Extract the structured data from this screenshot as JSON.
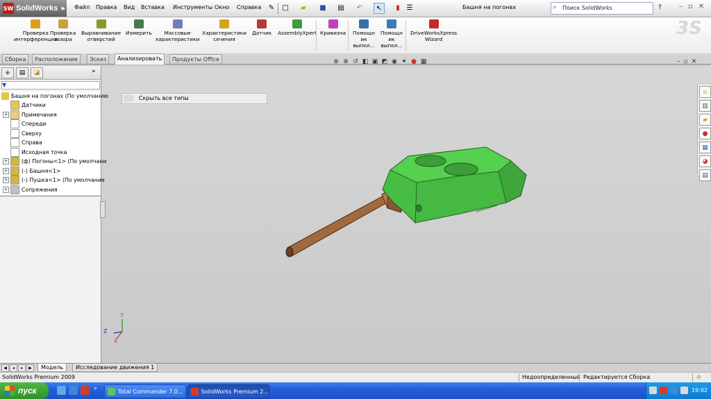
{
  "titlebar": {
    "app_name": "SolidWorks",
    "menu": [
      "Файл",
      "Правка",
      "Вид",
      "Вставка",
      "Инструменты",
      "Окно",
      "Справка"
    ],
    "document_title": "Башня на погонах",
    "search_placeholder": "Поиск SolidWorks",
    "help_label": "?"
  },
  "command_manager": {
    "items": [
      {
        "label": "Проверка\nинтерференции",
        "icon": "interference-check-icon",
        "color": "#d9a01b"
      },
      {
        "label": "Проверка\nзазора",
        "icon": "clearance-check-icon",
        "color": "#c8a23a"
      },
      {
        "label": "Выравнивание\nотверстий",
        "icon": "hole-alignment-icon",
        "color": "#8a9a2a"
      },
      {
        "label": "Измерить",
        "icon": "measure-icon",
        "color": "#4a7a4a"
      },
      {
        "label": "Массовые\nхарактеристики",
        "icon": "mass-properties-icon",
        "color": "#6f7fb5"
      },
      {
        "label": "Характеристики\nсечения",
        "icon": "section-properties-icon",
        "color": "#d4a41c"
      },
      {
        "label": "Датчик",
        "icon": "sensor-icon",
        "color": "#b53a3a"
      },
      {
        "label": "AssemblyXpert",
        "icon": "assemblyxpert-icon",
        "color": "#3c9d3c"
      },
      {
        "label": "Кривизна",
        "icon": "curvature-icon",
        "color": "#c23fbf"
      },
      {
        "label": "Помощн\nик\nвыпол...",
        "icon": "wizard-icon",
        "color": "#3a6fa9"
      },
      {
        "label": "Помощн\nик\nвыпол...",
        "icon": "wizard2-icon",
        "color": "#3c7bb3"
      },
      {
        "label": "DriveWorksXpress\nWizard",
        "icon": "driveworks-icon",
        "color": "#c52a2a"
      }
    ]
  },
  "tabs": [
    "Сборка",
    "Расположение",
    "Эскиз",
    "Анализировать",
    "Продукты Office"
  ],
  "active_tab": "Анализировать",
  "feature_tree": {
    "root": "Башня на погонах  (По умолчанию",
    "nodes": [
      {
        "label": "Датчики",
        "icon": "sensors-icon",
        "expandable": false
      },
      {
        "label": "Примечания",
        "icon": "annotations-icon",
        "expandable": true
      },
      {
        "label": "Спереди",
        "icon": "plane-icon",
        "expandable": false
      },
      {
        "label": "Сверху",
        "icon": "plane-icon",
        "expandable": false
      },
      {
        "label": "Справа",
        "icon": "plane-icon",
        "expandable": false
      },
      {
        "label": "Исходная точка",
        "icon": "origin-icon",
        "expandable": false
      },
      {
        "label": "(ф) Погоны<1> (По умолчани",
        "icon": "part-icon",
        "expandable": true
      },
      {
        "label": "(-) Башня<1>",
        "icon": "part-icon",
        "expandable": true
      },
      {
        "label": "(-) Пушка<1> (По умолчание",
        "icon": "part-icon",
        "expandable": true
      },
      {
        "label": "Сопряжения",
        "icon": "mates-icon",
        "expandable": true
      }
    ]
  },
  "context_menu": {
    "item": "Скрыть все типы"
  },
  "bottom_tabs": [
    "Модель",
    "Исследование движения 1"
  ],
  "status": {
    "left": "SolidWorks Premium 2009",
    "state": "Недоопределенный",
    "editing": "Редактируется Сборка"
  },
  "taskbar": {
    "start_label": "пуск",
    "buttons": [
      {
        "label": "Total Commander 7.0...",
        "active": false
      },
      {
        "label": "SolidWorks Premium 2...",
        "active": true
      }
    ],
    "clock": "19:02"
  },
  "axes_triad": {
    "x": "X",
    "y": "Y",
    "z": "Z"
  },
  "colors": {
    "turret": "#4fc44a",
    "turret_dark": "#3a9a37",
    "barrel": "#a36a3f",
    "viewport_bg": "#cbcbcb"
  }
}
